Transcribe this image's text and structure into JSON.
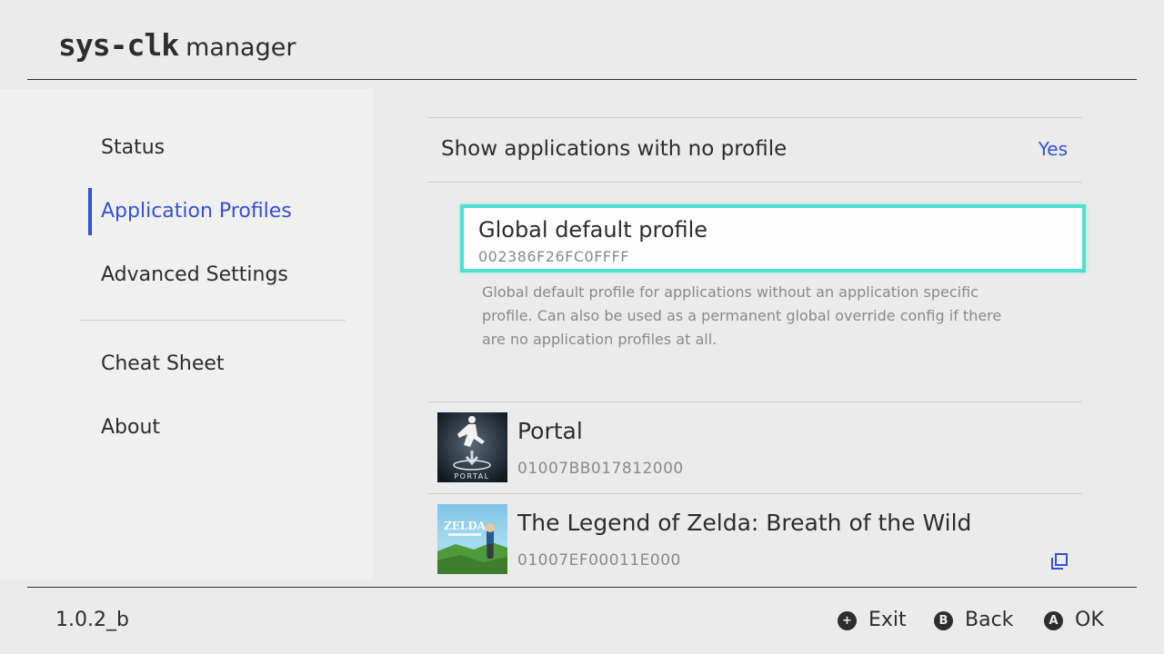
{
  "header": {
    "app_name": "sys-clk",
    "subtitle": "manager"
  },
  "sidebar": {
    "items": [
      {
        "label": "Status"
      },
      {
        "label": "Application Profiles",
        "active": true
      },
      {
        "label": "Advanced Settings"
      },
      {
        "label": "Cheat Sheet"
      },
      {
        "label": "About"
      }
    ]
  },
  "main": {
    "toggle": {
      "label": "Show applications with no profile",
      "value": "Yes"
    },
    "global_profile": {
      "title": "Global default profile",
      "id": "002386F26FC0FFFF",
      "description": "Global default profile for applications without an application specific profile. Can also be used as a permanent global override config if there are no application profiles at all."
    },
    "apps": [
      {
        "name": "Portal",
        "id": "01007BB017812000",
        "icon": "portal-thumbnail",
        "thumb_text": "PORTAL"
      },
      {
        "name": "The Legend of Zelda: Breath of the Wild",
        "id": "01007EF00011E000",
        "icon": "zelda-thumbnail",
        "thumb_text": "ZELDA"
      }
    ]
  },
  "footer": {
    "version": "1.0.2_b",
    "hints": [
      {
        "button": "+",
        "label": "Exit"
      },
      {
        "button": "B",
        "label": "Back"
      },
      {
        "button": "A",
        "label": "OK"
      }
    ]
  },
  "colors": {
    "accent": "#3450d8",
    "focus": "#4fdfd2",
    "background": "#ebebeb",
    "sidebar": "#f0f0f0"
  }
}
